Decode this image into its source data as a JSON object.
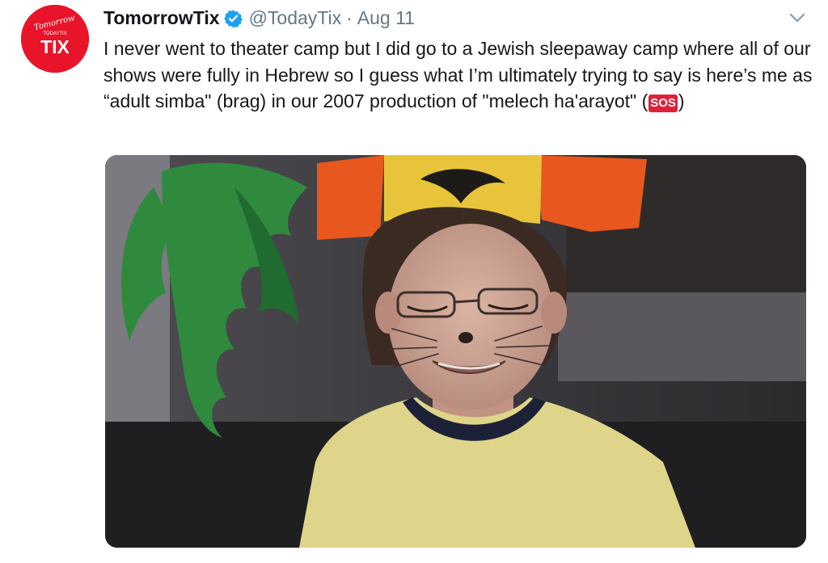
{
  "tweet": {
    "display_name": "TomorrowTix",
    "handle": "@TodayTix",
    "separator": "·",
    "date": "Aug 11",
    "text_before_emoji": "I never went to theater camp but I did go to a Jewish sleepaway camp where all of our shows were fully in Hebrew so I guess what I’m ultimately trying to say is here’s me as “adult simba\" (brag) in our 2007 production of \"melech ha'arayot\" (",
    "emoji_label": "SOS",
    "text_after_emoji": ")"
  },
  "avatar": {
    "logo_line1": "Tomorrow",
    "logo_line2": "TODAYTIX",
    "logo_main": "TIX",
    "background": "#e8142a"
  },
  "icons": {
    "verified": "verified-badge-icon",
    "more": "chevron-down-icon"
  },
  "colors": {
    "name": "#14171a",
    "secondary": "#657786",
    "verified": "#1da1f2",
    "emoji_bg": "#e0203a"
  }
}
